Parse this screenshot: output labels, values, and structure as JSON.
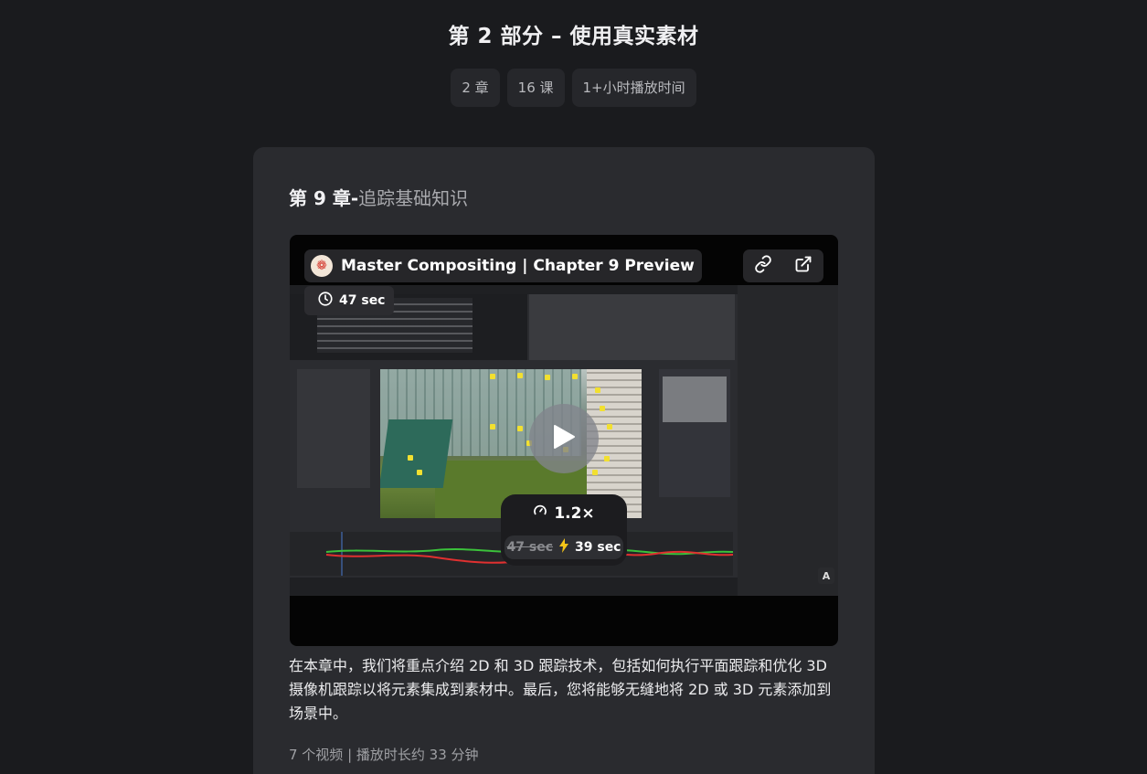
{
  "part": {
    "title": "第 2 部分 – 使用真实素材"
  },
  "stats": [
    "2 章",
    "16 课",
    "1+小时播放时间"
  ],
  "chapter": {
    "label": "第 9 章",
    "separator": "-",
    "name": "追踪基础知识",
    "video": {
      "title": "Master Compositing | Chapter 9 Preview",
      "duration": "47 sec",
      "speed": "1.2×",
      "original_time": "47 sec",
      "fast_time": "39 sec",
      "corner_badge": "A",
      "icons": [
        "brand-logo-icon",
        "link-icon",
        "external-link-icon",
        "clock-icon",
        "play-icon",
        "gauge-icon",
        "lightning-icon"
      ]
    },
    "description": "在本章中，我们将重点介绍 2D 和 3D 跟踪技术，包括如何执行平面跟踪和优化 3D 摄像机跟踪以将元素集成到素材中。最后，您将能够无缝地将 2D 或 3D 元素添加到场景中。",
    "meta": "7 个视频 | 播放时长约 33 分钟"
  },
  "colors": {
    "background": "#1a1b1e",
    "card": "#2a2b2f",
    "pill": "#26272b",
    "marker": "#f2e030"
  }
}
